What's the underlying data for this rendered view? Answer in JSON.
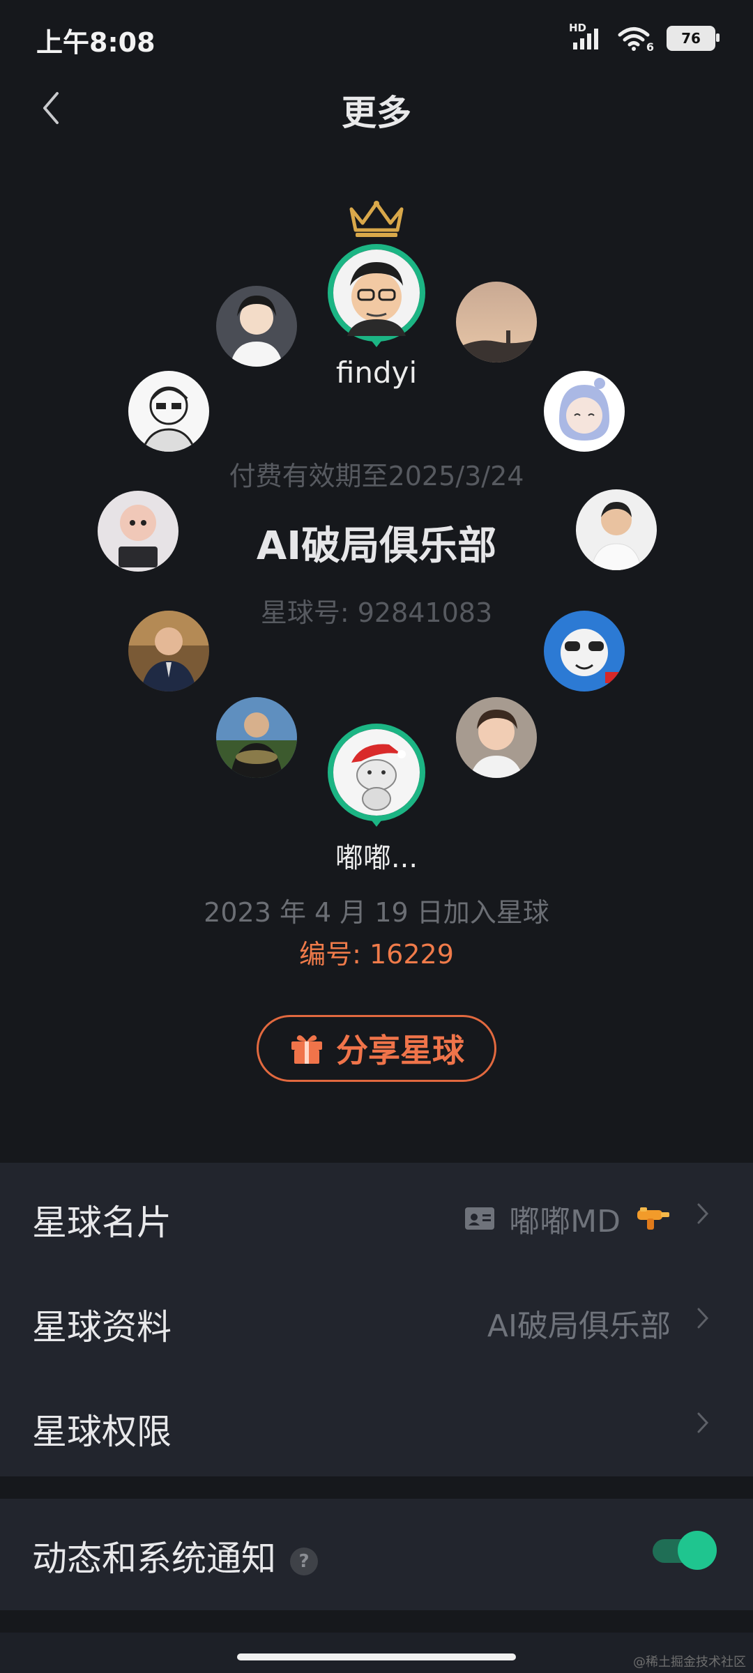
{
  "status": {
    "time": "上午8:08",
    "hd": "HD",
    "wifi_sub": "6",
    "battery": "76"
  },
  "nav": {
    "title": "更多"
  },
  "owner": {
    "name": "findyi"
  },
  "group": {
    "paid_until": "付费有效期至2025/3/24",
    "name": "AI破局俱乐部",
    "planet_number": "星球号: 92841083"
  },
  "me": {
    "name": "嘟嘟...",
    "join_date": "2023 年 4 月 19 日加入星球",
    "member_number": "编号: 16229"
  },
  "share": {
    "label": "分享星球"
  },
  "menu": {
    "card_label": "星球名片",
    "card_value": "嘟嘟MD",
    "info_label": "星球资料",
    "info_value": "AI破局俱乐部",
    "perm_label": "星球权限"
  },
  "notify": {
    "label": "动态和系统通知",
    "help": "?",
    "enabled": true
  },
  "accent": "#1cb584",
  "share_color": "#f0744a",
  "watermark": "@稀土掘金技术社区"
}
